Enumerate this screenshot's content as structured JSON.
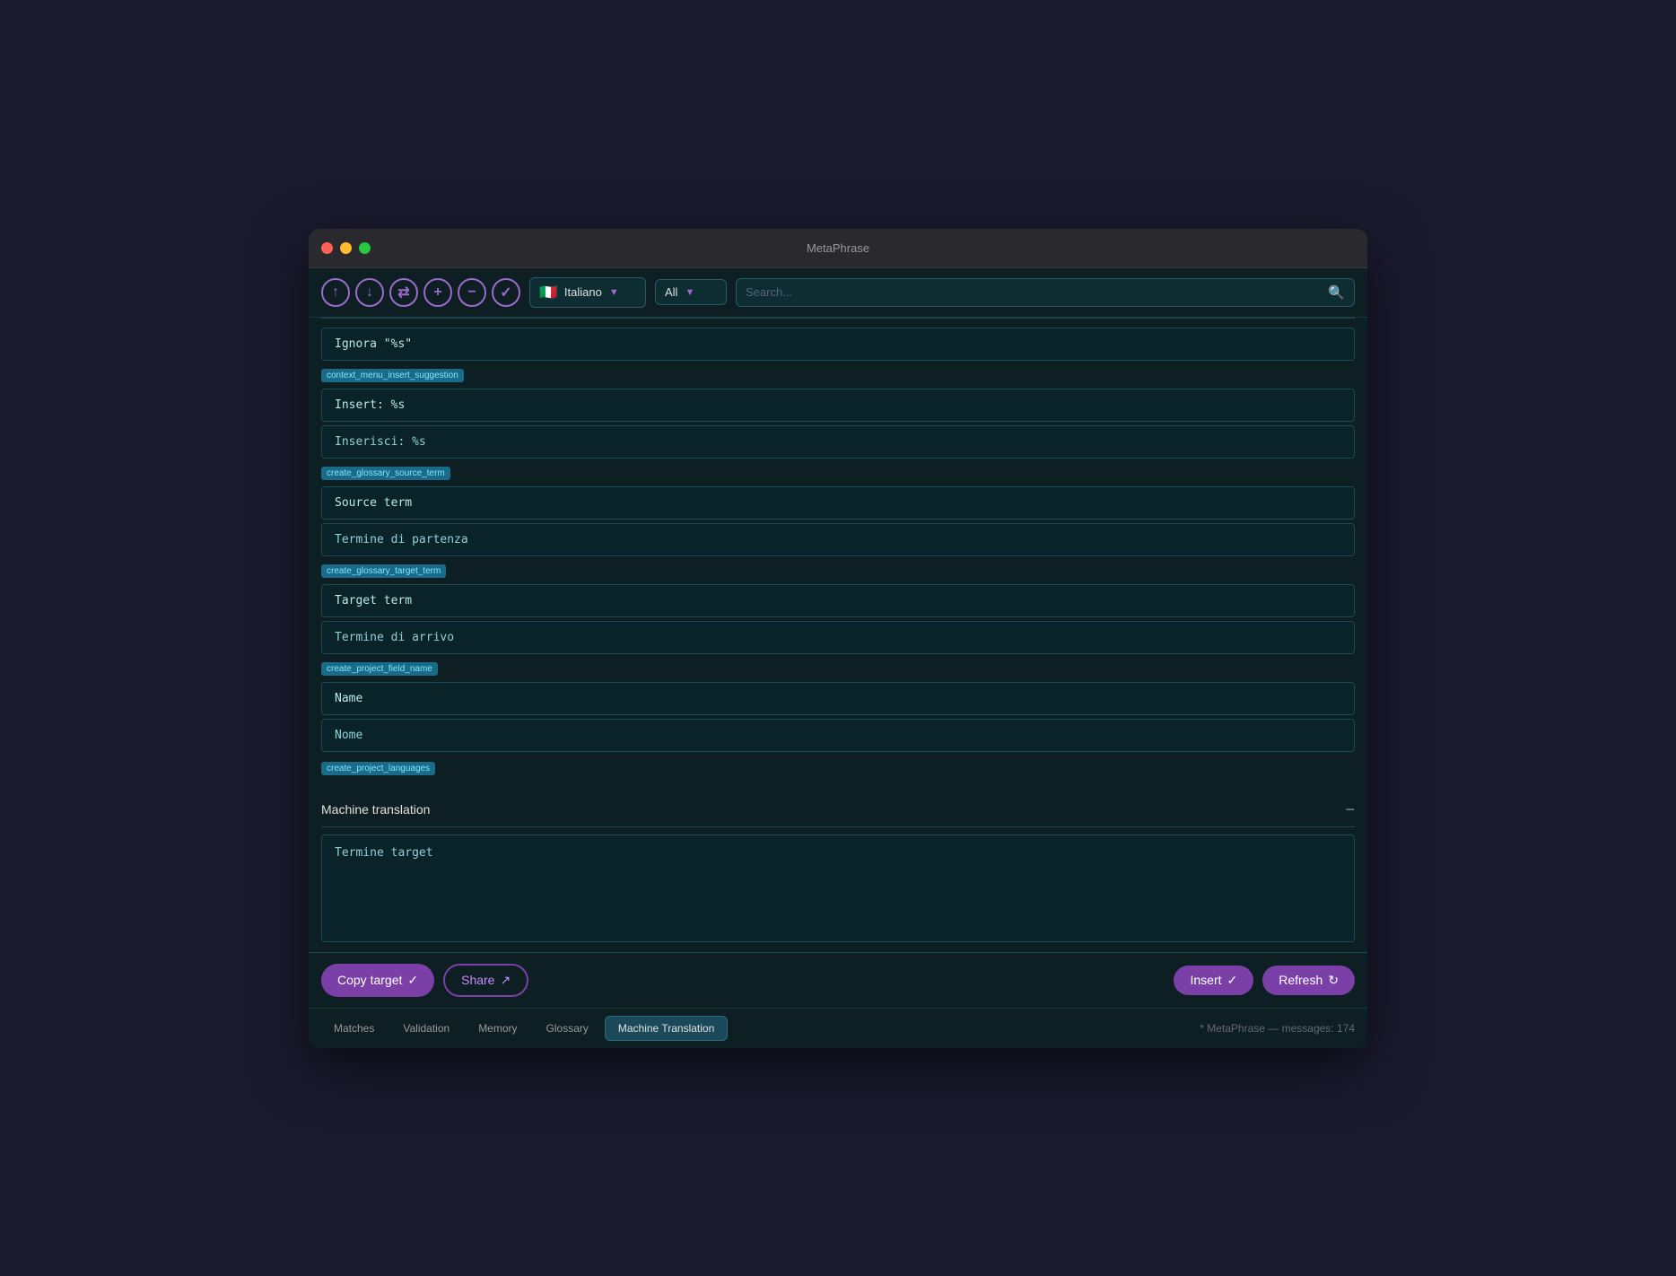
{
  "window": {
    "title": "MetaPhrase"
  },
  "toolbar": {
    "language": {
      "flag": "🇮🇹",
      "name": "Italiano"
    },
    "filter": "All",
    "search_placeholder": "Search..."
  },
  "rows": [
    {
      "id": "row-ignore",
      "label": null,
      "source": "Ignora \"%s\"",
      "target": null
    },
    {
      "id": "row-insert-label",
      "label": "context_menu_insert_suggestion",
      "source": "Insert: %s",
      "target": "Inserisci: %s"
    },
    {
      "id": "row-glossary-source",
      "label": "create_glossary_source_term",
      "source": "Source term",
      "target": "Termine di partenza"
    },
    {
      "id": "row-glossary-target",
      "label": "create_glossary_target_term",
      "source": "Target term",
      "target": "Termine di arrivo"
    },
    {
      "id": "row-project-name",
      "label": "create_project_field_name",
      "source": "Name",
      "target": "Nome"
    }
  ],
  "machine_translation": {
    "header": "Machine translation",
    "collapse_symbol": "−",
    "textarea_value": "Termine target"
  },
  "actions": {
    "copy_target": "Copy target",
    "copy_target_icon": "✓",
    "share": "Share",
    "share_icon": "↗",
    "insert": "Insert",
    "insert_icon": "✓",
    "refresh": "Refresh",
    "refresh_icon": "↻"
  },
  "tabs": [
    {
      "id": "matches",
      "label": "Matches",
      "active": false
    },
    {
      "id": "validation",
      "label": "Validation",
      "active": false
    },
    {
      "id": "memory",
      "label": "Memory",
      "active": false
    },
    {
      "id": "glossary",
      "label": "Glossary",
      "active": false
    },
    {
      "id": "machine-translation",
      "label": "Machine Translation",
      "active": true
    }
  ],
  "status": {
    "text": "* MetaPhrase — messages: 174"
  },
  "partially_visible_label": "create_project_languages"
}
